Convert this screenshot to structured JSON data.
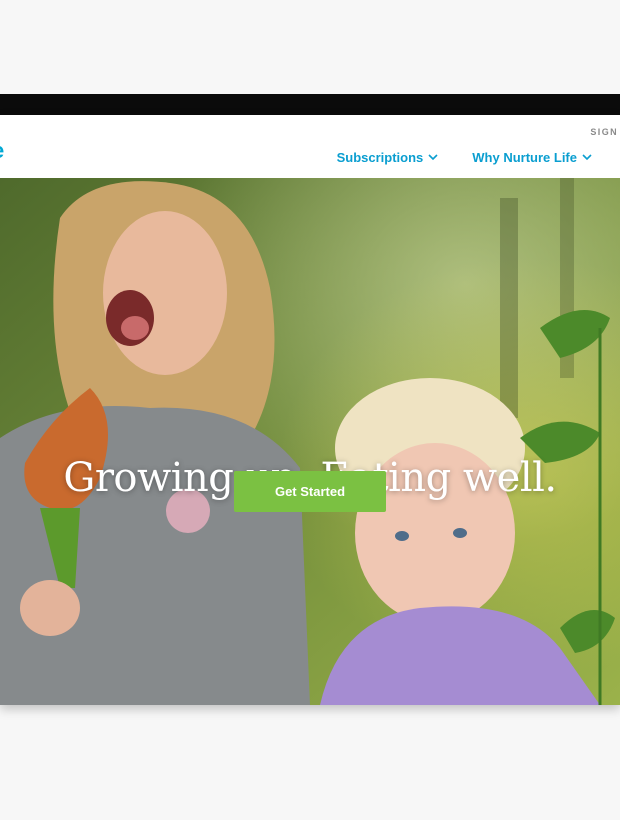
{
  "header": {
    "logo_text": "e",
    "signin_label": "SIGN",
    "nav": [
      {
        "label": "Subscriptions",
        "icon": "chevron-down-icon"
      },
      {
        "label": "Why Nurture Life",
        "icon": "chevron-down-icon"
      }
    ]
  },
  "hero": {
    "headline": "Growing up. Eating well.",
    "cta_label": "Get Started"
  },
  "colors": {
    "accent": "#0a9ed0",
    "cta": "#7bc142"
  }
}
